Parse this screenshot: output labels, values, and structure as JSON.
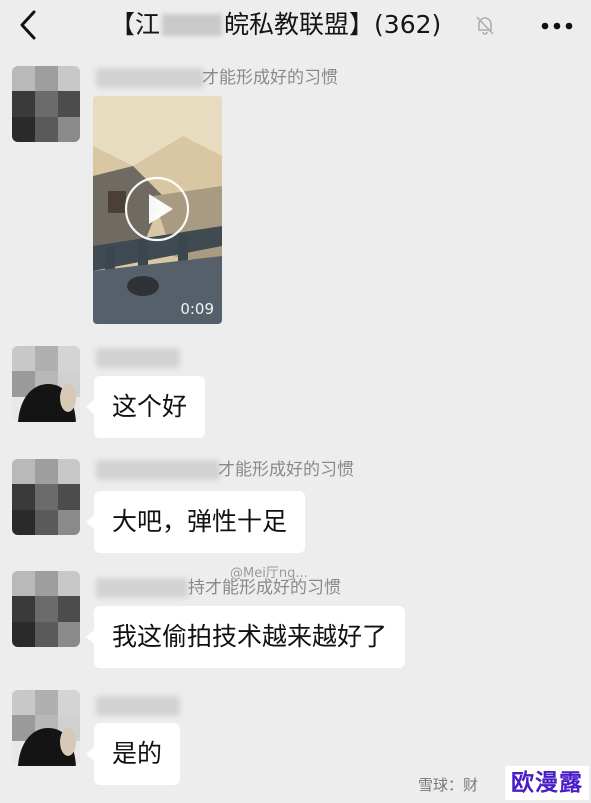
{
  "header": {
    "title_prefix": "【江",
    "title_suffix": "皖私教联盟】",
    "member_count": "(362)",
    "back_icon": "chevron-left-icon",
    "mute_icon": "bell-off-icon",
    "more_icon": "more-dots-icon"
  },
  "messages": [
    {
      "nickname_visible": "才能形成好的习惯",
      "type": "video",
      "duration": "0:09"
    },
    {
      "nickname_visible": "",
      "type": "text",
      "text": "这个好"
    },
    {
      "nickname_visible": "才能形成好的习惯",
      "type": "text",
      "text": "大吧，弹性十足"
    },
    {
      "nickname_visible": "持才能形成好的习惯",
      "type": "text",
      "text": "我这偷拍技术越来越好了"
    },
    {
      "nickname_visible": "",
      "type": "text",
      "text": "是的"
    }
  ],
  "watermark": {
    "weibo_handle": "@Mei厅ng...",
    "site_label": "雪球：财",
    "brand": "欧漫露"
  }
}
